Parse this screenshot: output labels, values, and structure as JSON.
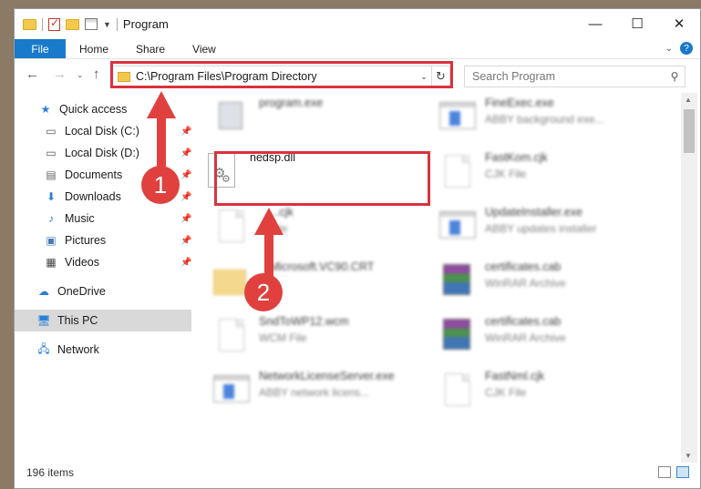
{
  "window": {
    "title": "Program",
    "controls": {
      "minimize": "—",
      "maximize": "☐",
      "close": "✕"
    }
  },
  "ribbon": {
    "tabs": [
      "File",
      "Home",
      "Share",
      "View"
    ],
    "help": "?"
  },
  "nav": {
    "address": "C:\\Program Files\\Program Directory",
    "search_placeholder": "Search Program"
  },
  "sidebar": {
    "items": [
      {
        "label": "Quick access",
        "icon": "star-icon"
      },
      {
        "label": "Local Disk (C:)",
        "icon": "drive-icon",
        "pinned": true
      },
      {
        "label": "Local Disk (D:)",
        "icon": "drive-icon",
        "pinned": true
      },
      {
        "label": "Documents",
        "icon": "documents-icon",
        "pinned": true
      },
      {
        "label": "Downloads",
        "icon": "download-arrow-icon",
        "pinned": true
      },
      {
        "label": "Music",
        "icon": "music-note-icon",
        "pinned": true
      },
      {
        "label": "Pictures",
        "icon": "pictures-icon",
        "pinned": true
      },
      {
        "label": "Videos",
        "icon": "videos-icon",
        "pinned": true
      },
      {
        "label": "OneDrive",
        "icon": "cloud-icon"
      },
      {
        "label": "This PC",
        "icon": "computer-icon",
        "selected": true
      },
      {
        "label": "Network",
        "icon": "network-icon"
      }
    ]
  },
  "files": [
    {
      "name": "program.exe",
      "desc": "",
      "icon": "exe-icon",
      "blurred": true
    },
    {
      "name": "FineExec.exe",
      "desc": "ABBY background exe...",
      "icon": "app-icon",
      "blurred": true
    },
    {
      "name": "nedsp.dll",
      "desc": "",
      "icon": "dll-gear-icon",
      "blurred": false
    },
    {
      "name": "FastKom.cjk",
      "desc": "CJK File",
      "icon": "document-icon",
      "blurred": true
    },
    {
      "name": "...cjk",
      "desc": "File",
      "icon": "document-icon",
      "blurred": true
    },
    {
      "name": "UpdateInstaller.exe",
      "desc": "ABBY updates installer",
      "icon": "app-icon",
      "blurred": true
    },
    {
      "name": "Microsoft.VC90.CRT",
      "desc": "",
      "icon": "folder-icon",
      "blurred": true
    },
    {
      "name": "certificates.cab",
      "desc": "WinRAR Archive",
      "icon": "rar-archive-icon",
      "blurred": true
    },
    {
      "name": "SndToWP12.wcm",
      "desc": "WCM File",
      "icon": "document-icon",
      "blurred": true
    },
    {
      "name": "certificates.cab",
      "desc": "WinRAR Archive",
      "icon": "rar-archive-icon",
      "blurred": true
    },
    {
      "name": "NetworkLicenseServer.exe",
      "desc": "ABBY network licens...",
      "icon": "app-icon",
      "blurred": true
    },
    {
      "name": "FastNml.cjk",
      "desc": "CJK File",
      "icon": "document-icon",
      "blurred": true
    }
  ],
  "status": {
    "item_count": "196 items"
  },
  "annotations": {
    "step1": "1",
    "step2": "2"
  },
  "colors": {
    "accent": "#1979ca",
    "highlight": "#d8333e",
    "arrow": "#e0413f"
  }
}
